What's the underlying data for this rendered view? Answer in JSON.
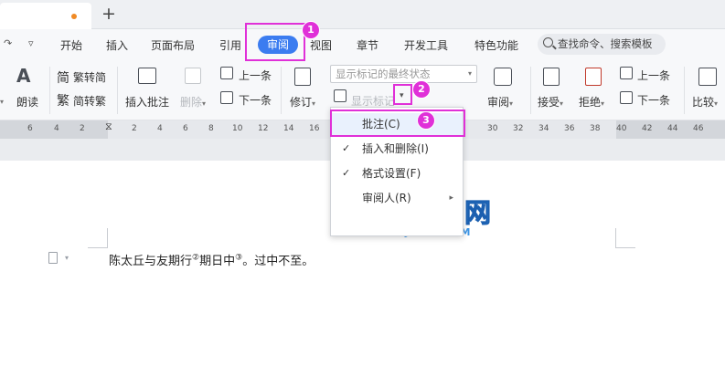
{
  "menu": {
    "items": [
      "开始",
      "插入",
      "页面布局",
      "引用",
      "审阅",
      "视图",
      "章节",
      "开发工具",
      "特色功能"
    ],
    "active": "审阅",
    "search_placeholder": "查找命令、搜索模板"
  },
  "ribbon": {
    "read_aloud": "朗读",
    "trad_to_simp": "繁转简",
    "simp_to_trad": "简转繁",
    "insert_comment": "插入批注",
    "delete": "删除",
    "prev_comment": "上一条",
    "next_comment": "下一条",
    "track_changes": "修订",
    "markup_state": "显示标记的最终状态",
    "show_markup": "显示标记",
    "review": "审阅",
    "accept": "接受",
    "reject": "拒绝",
    "prev_change": "上一条",
    "next_change": "下一条",
    "compare": "比较"
  },
  "ruler": {
    "ticks": [
      "6",
      "4",
      "2",
      "2",
      "4",
      "6",
      "8",
      "10",
      "12",
      "14",
      "16",
      "30",
      "32",
      "34",
      "36",
      "38",
      "40",
      "42",
      "44",
      "46"
    ]
  },
  "dropdown_menu": {
    "items": [
      {
        "label": "批注(C)",
        "checked": false
      },
      {
        "label": "插入和删除(I)",
        "checked": true
      },
      {
        "label": "格式设置(F)",
        "checked": true
      },
      {
        "label": "审阅人(R)",
        "checked": false
      }
    ]
  },
  "document": {
    "line_part1": "陈太丘与友期行",
    "note1": "②",
    "line_part2": "期日中",
    "note2": "③",
    "line_part3": "。过中不至。"
  },
  "annotations": {
    "badge1": "1",
    "badge2": "2",
    "badge3": "3"
  },
  "watermark": {
    "main": "软件自学网",
    "sub": "WWW.RJZXW.COM"
  },
  "colors": {
    "accent": "#3b7cf0",
    "annotation": "#e030d8",
    "watermark": "#3c96e8"
  }
}
